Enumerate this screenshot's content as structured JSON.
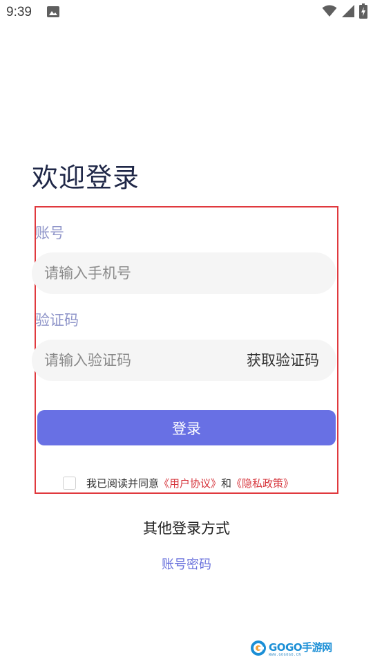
{
  "status_bar": {
    "time": "9:39"
  },
  "login": {
    "title": "欢迎登录",
    "account_label": "账号",
    "phone_placeholder": "请输入手机号",
    "code_label": "验证码",
    "code_placeholder": "请输入验证码",
    "get_code_label": "获取验证码",
    "submit_label": "登录"
  },
  "agreement": {
    "prefix": "我已阅读并同意",
    "user_agreement": "《用户协议》",
    "conjunction": "和",
    "privacy_policy": "《隐私政策》",
    "checked": false
  },
  "other_login": {
    "title": "其他登录方式",
    "account_password": "账号密码"
  },
  "watermark": {
    "brand_latin": "GOGO",
    "brand_cn": "手游网",
    "url": "WWW.GOGOGO.CN"
  },
  "colors": {
    "title": "#1f2747",
    "label": "#8f95c9",
    "primary_button": "#6870e4",
    "link_red": "#d6333a",
    "link_blue": "#6a72dc",
    "highlight_box": "#e0393e"
  },
  "icons": [
    "image-notification-icon",
    "wifi-icon",
    "signal-icon",
    "battery-icon",
    "gogo-logo-icon"
  ]
}
